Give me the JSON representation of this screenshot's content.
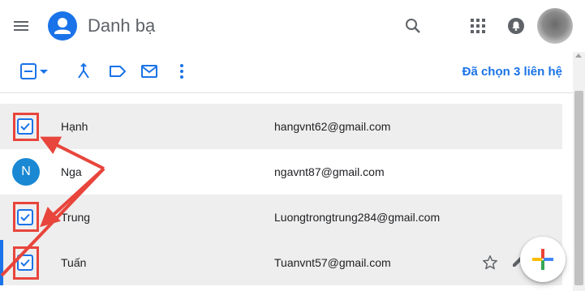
{
  "header": {
    "title": "Danh bạ"
  },
  "toolbar": {
    "selected_label": "Đã chọn 3 liên hệ"
  },
  "contacts": [
    {
      "name": "Hạnh",
      "email": "hangvnt62@gmail.com",
      "selected": true
    },
    {
      "name": "Nga",
      "email": "ngavnt87@gmail.com",
      "selected": false,
      "avatar_letter": "N"
    },
    {
      "name": "Trung",
      "email": "Luongtrongtrung284@gmail.com",
      "selected": true
    },
    {
      "name": "Tuấn",
      "email": "Tuanvnt57@gmail.com",
      "selected": true
    }
  ],
  "colors": {
    "accent": "#1a73e8",
    "annotation": "#e8453c",
    "selected_row": "#eeeeee",
    "avatar_blue": "#1a88d2"
  },
  "icons": [
    "menu-icon",
    "contacts-logo-icon",
    "search-icon",
    "apps-grid-icon",
    "notifications-icon",
    "select-checkbox-icon",
    "dropdown-arrow-icon",
    "merge-icon",
    "label-icon",
    "email-icon",
    "more-vert-icon",
    "star-icon",
    "edit-icon",
    "add-plus-icon"
  ]
}
